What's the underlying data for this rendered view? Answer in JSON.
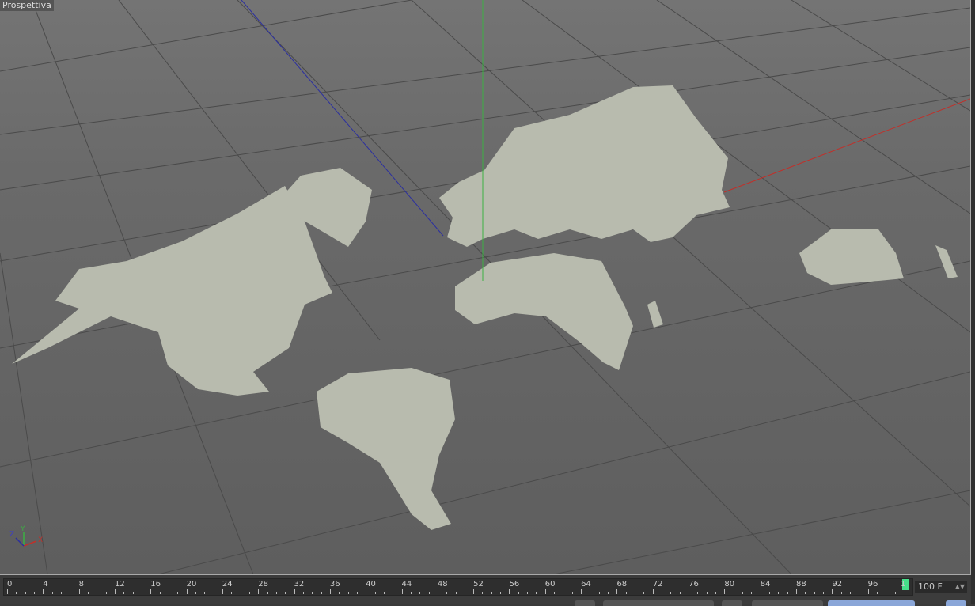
{
  "viewport": {
    "label": "Prospettiva",
    "gizmo": {
      "x": "X",
      "y": "Y",
      "z": "Z"
    }
  },
  "timeline": {
    "tick_labels": [
      "0",
      "4",
      "8",
      "12",
      "16",
      "20",
      "24",
      "28",
      "32",
      "36",
      "40",
      "44",
      "48",
      "52",
      "56",
      "60",
      "64",
      "68",
      "72",
      "76",
      "80",
      "84",
      "88",
      "92",
      "96"
    ],
    "end_label": "1",
    "current_frame": 100,
    "max_frame": 100,
    "frame_field": "100 F"
  },
  "colors": {
    "land": "#b8bbae",
    "x_axis": "#c0302a",
    "y_axis": "#3cb043",
    "z_axis": "#2b2fa0",
    "playhead": "#46e08a"
  }
}
